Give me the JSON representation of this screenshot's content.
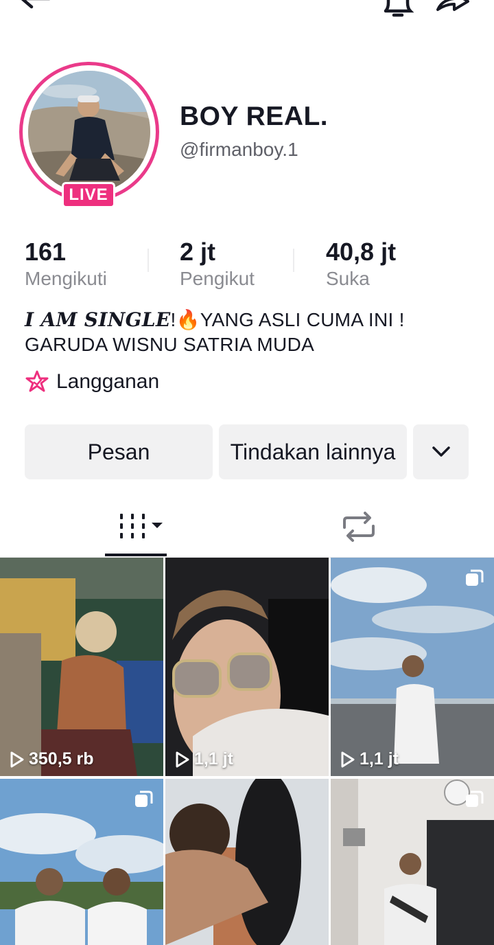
{
  "profile": {
    "display_name": "BOY REAL.",
    "username": "@firmanboy.1",
    "live_badge": "LIVE"
  },
  "stats": {
    "following": {
      "value": "161",
      "label": "Mengikuti"
    },
    "followers": {
      "value": "2 jt",
      "label": "Pengikut"
    },
    "likes": {
      "value": "40,8 jt",
      "label": "Suka"
    }
  },
  "bio": {
    "fancy": "I AM SINGLE",
    "line1_rest": "!🔥YANG ASLI CUMA INI !",
    "line2": "GARUDA WISNU SATRIA MUDA"
  },
  "subscription": {
    "label": "Langganan",
    "icon": "star-badge-icon"
  },
  "actions": {
    "message_label": "Pesan",
    "more_label": "Tindakan lainnya",
    "dropdown_icon": "chevron-down-icon"
  },
  "tabs": [
    {
      "name": "videos",
      "icon": "grid-icon"
    },
    {
      "name": "reposts",
      "icon": "repost-icon"
    }
  ],
  "videos": [
    {
      "views": "350,5 rb",
      "multi": false
    },
    {
      "views": "1,1 jt",
      "multi": false
    },
    {
      "views": "1,1 jt",
      "multi": true
    },
    {
      "views": "",
      "multi": true
    },
    {
      "views": "",
      "multi": false
    },
    {
      "views": "",
      "multi": true
    }
  ],
  "colors": {
    "accent": "#ee2f7e",
    "text": "#161823",
    "muted": "#8a8b91"
  }
}
